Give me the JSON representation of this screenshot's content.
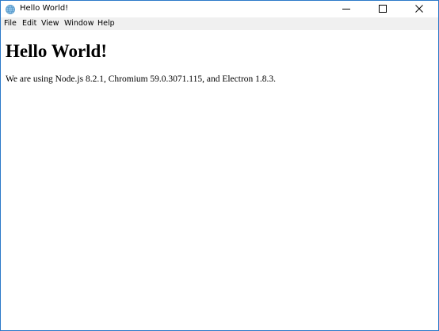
{
  "window": {
    "title": "Hello World!",
    "app_icon": "electron-globe-icon",
    "controls": [
      "minimize-icon",
      "maximize-icon",
      "close-icon"
    ]
  },
  "menu": {
    "items": [
      {
        "label": "File"
      },
      {
        "label": "Edit"
      },
      {
        "label": "View"
      },
      {
        "label": "Window"
      },
      {
        "label": "Help"
      }
    ]
  },
  "page": {
    "heading": "Hello World!",
    "body": "We are using Node.js 8.2.1, Chromium 59.0.3071.115, and Electron 1.8.3."
  },
  "colors": {
    "window_border": "#2b79c9",
    "menubar_background": "#f0f0f0",
    "text": "#000000",
    "background": "#ffffff"
  }
}
